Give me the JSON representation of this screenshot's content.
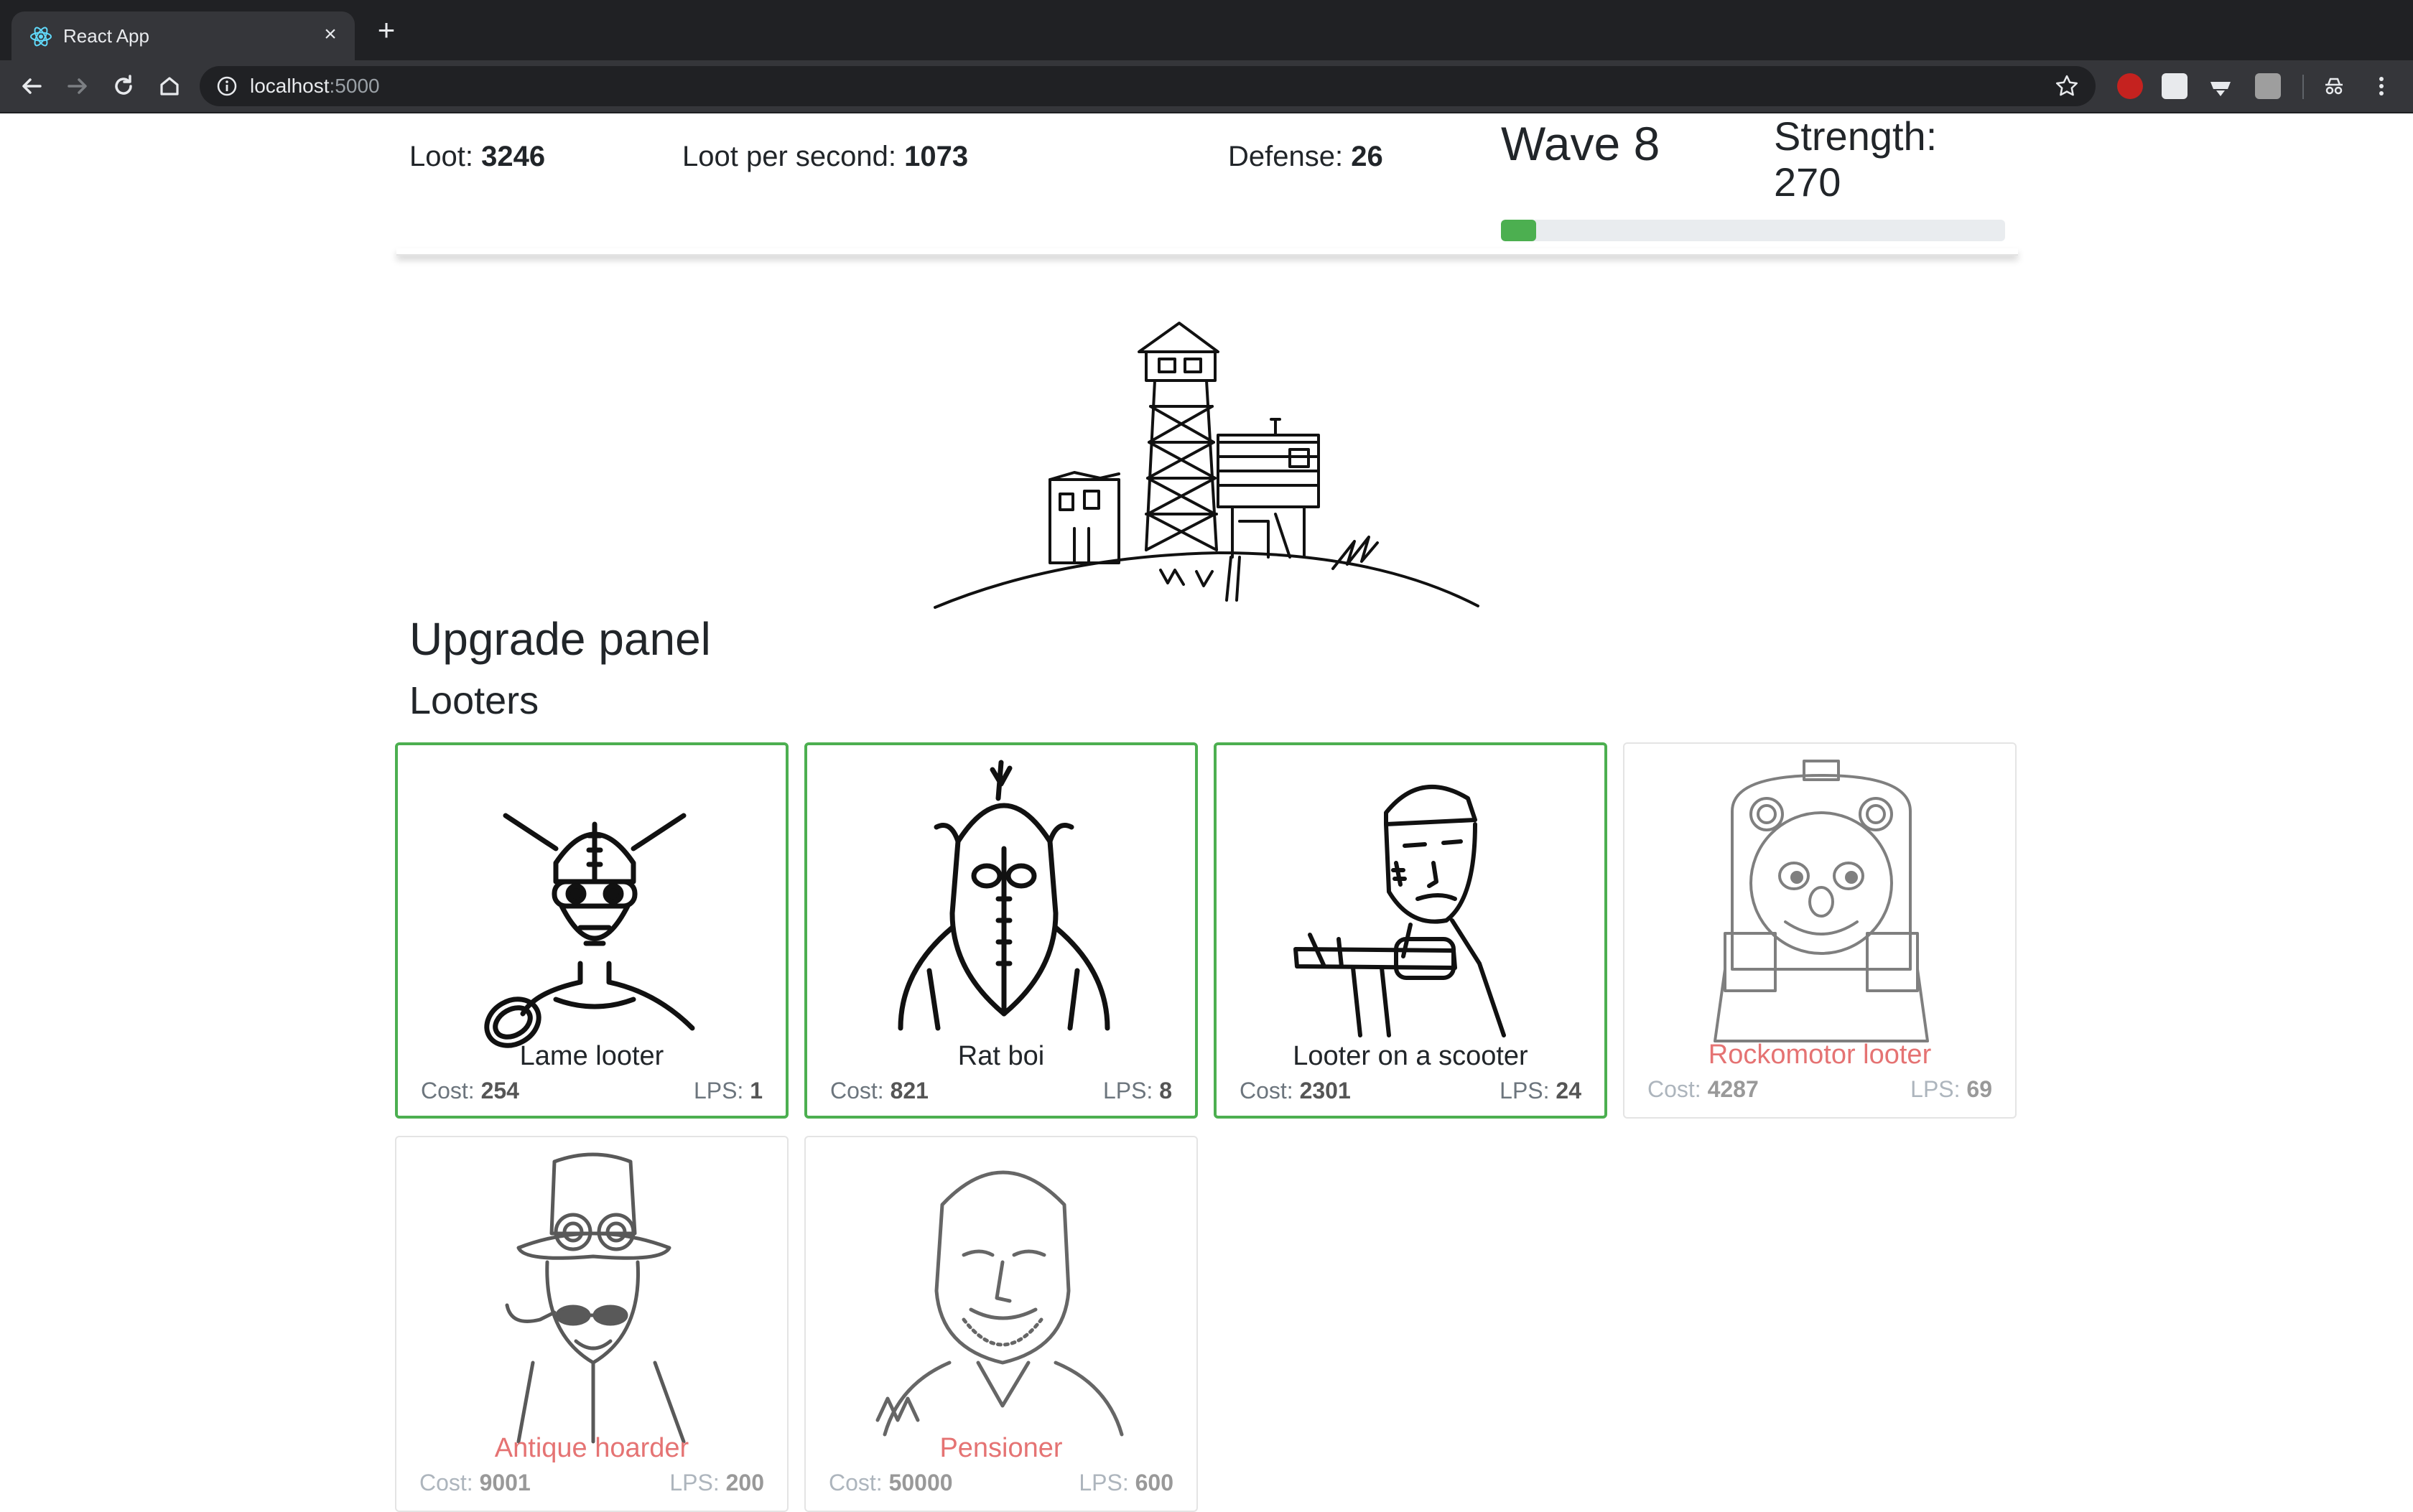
{
  "browser": {
    "tab_title": "React App",
    "url_host": "localhost",
    "url_port": ":5000"
  },
  "stats": {
    "loot_label": "Loot:",
    "loot_value": "3246",
    "lps_label": "Loot per second:",
    "lps_value": "1073",
    "defense_label": "Defense:",
    "defense_value": "26",
    "wave_label": "Wave 8",
    "strength_label": "Strength:",
    "strength_value": "270",
    "wave_progress": 0.07,
    "progress_color": "#4caf50"
  },
  "upgrade_panel": {
    "title": "Upgrade panel",
    "section_title": "Looters",
    "cost_label": "Cost:",
    "lps_label": "LPS:",
    "looters": [
      {
        "name": "Lame looter",
        "cost": "254",
        "lps": "1",
        "affordable": true,
        "icon": "goggled-helmet-looter-icon"
      },
      {
        "name": "Rat boi",
        "cost": "821",
        "lps": "8",
        "affordable": true,
        "icon": "masked-rat-icon"
      },
      {
        "name": "Looter on a scooter",
        "cost": "2301",
        "lps": "24",
        "affordable": true,
        "icon": "headband-scooter-man-icon"
      },
      {
        "name": "Rockomotor looter",
        "cost": "4287",
        "lps": "69",
        "affordable": false,
        "icon": "train-face-icon"
      },
      {
        "name": "Antique hoarder",
        "cost": "9001",
        "lps": "200",
        "affordable": false,
        "icon": "top-hat-steampunk-icon"
      },
      {
        "name": "Pensioner",
        "cost": "50000",
        "lps": "600",
        "affordable": false,
        "icon": "old-man-icon"
      }
    ]
  },
  "colors": {
    "affordable_border": "#4caf50",
    "locked_name": "#e57373"
  }
}
